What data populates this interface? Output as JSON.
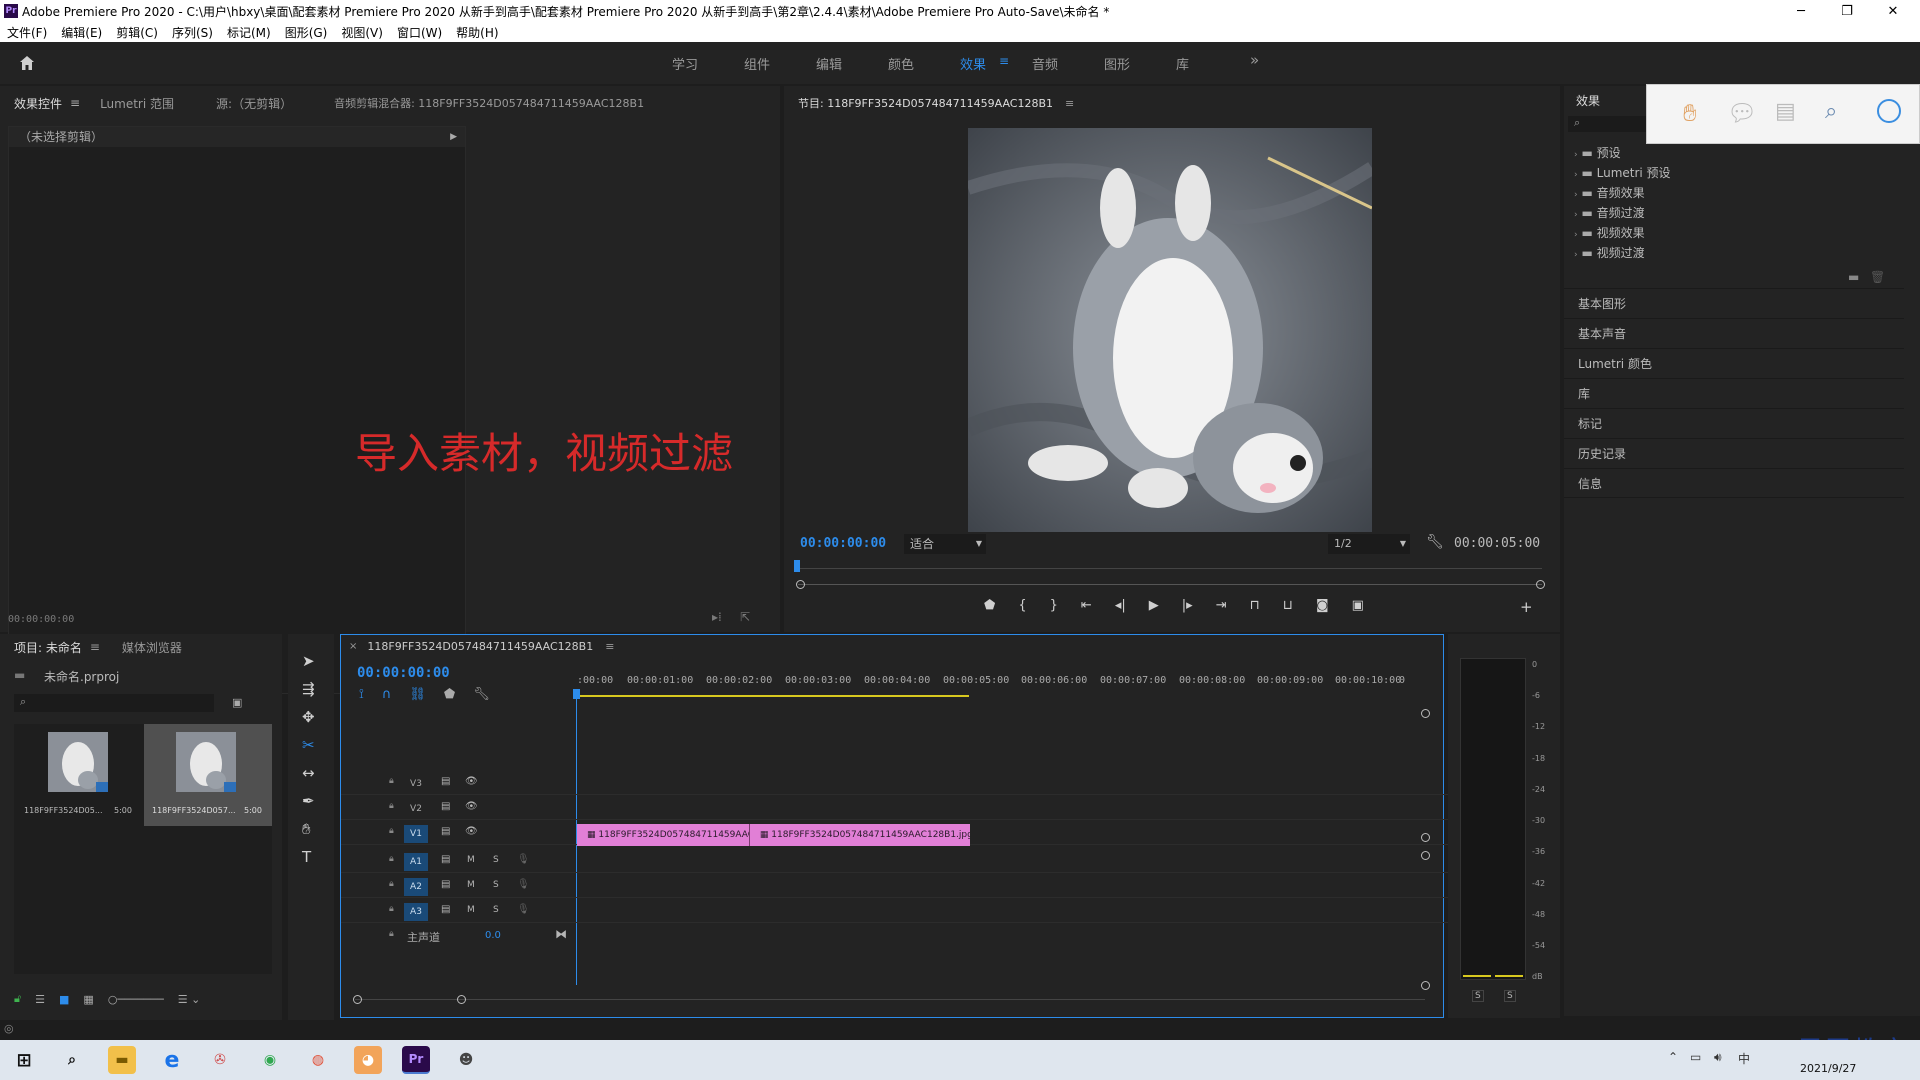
{
  "window": {
    "title": "Adobe Premiere Pro 2020 - C:\\用户\\hbxy\\桌面\\配套素材 Premiere Pro 2020 从新手到高手\\配套素材 Premiere Pro 2020 从新手到高手\\第2章\\2.4.4\\素材\\Adobe Premiere Pro Auto-Save\\未命名 *",
    "logo": "Pr"
  },
  "menu": [
    "文件(F)",
    "编辑(E)",
    "剪辑(C)",
    "序列(S)",
    "标记(M)",
    "图形(G)",
    "视图(V)",
    "窗口(W)",
    "帮助(H)"
  ],
  "workspaces": {
    "items": [
      "学习",
      "组件",
      "编辑",
      "颜色",
      "效果",
      "音频",
      "图形",
      "库"
    ],
    "active": "效果",
    "more": "»"
  },
  "source_panel": {
    "tabs": [
      "效果控件",
      "Lumetri 范围",
      "源:（无剪辑）",
      "音频剪辑混合器: 118F9FF3524D057484711459AAC128B1"
    ],
    "no_clip": "（未选择剪辑）",
    "timecode": "00:00:00:00"
  },
  "overlay_caption": "导入素材，视频过滤",
  "program_monitor": {
    "title": "节目: 118F9FF3524D057484711459AAC128B1",
    "timecode": "00:00:00:00",
    "zoom": "适合",
    "resolution": "1/2",
    "duration": "00:00:05:00",
    "playhead_fraction": 0.0
  },
  "effects_panel": {
    "title": "效果",
    "tree": [
      "预设",
      "Lumetri 预设",
      "音频效果",
      "音频过渡",
      "视频效果",
      "视频过渡"
    ],
    "sections": [
      "基本图形",
      "基本声音",
      "Lumetri 颜色",
      "库",
      "标记",
      "历史记录",
      "信息"
    ]
  },
  "project_panel": {
    "tabs": [
      "项目: 未命名",
      "媒体浏览器"
    ],
    "project_file": "未命名.prproj",
    "items": [
      {
        "name": "118F9FF3524D05...",
        "duration": "5:00",
        "selected": false
      },
      {
        "name": "118F9FF3524D057...",
        "duration": "5:00",
        "selected": true
      }
    ]
  },
  "timeline": {
    "tab": "118F9FF3524D057484711459AAC128B1",
    "timecode": "00:00:00:00",
    "ruler": [
      ":00:00",
      "00:00:01:00",
      "00:00:02:00",
      "00:00:03:00",
      "00:00:04:00",
      "00:00:05:00",
      "00:00:06:00",
      "00:00:07:00",
      "00:00:08:00",
      "00:00:09:00",
      "00:00:10:00",
      "0"
    ],
    "video_tracks": [
      "V3",
      "V2",
      "V1"
    ],
    "audio_tracks": [
      "A1",
      "A2",
      "A3"
    ],
    "master": {
      "label": "主声道",
      "value": "0.0"
    },
    "clips": [
      {
        "label": "118F9FF3524D057484711459AAC",
        "track": "V1",
        "start": 0.0,
        "end": 2.2
      },
      {
        "label": "118F9FF3524D057484711459AAC128B1.jpg",
        "track": "V1",
        "start": 2.2,
        "end": 5.0
      }
    ],
    "track_buttons": {
      "mute": "M",
      "solo": "S"
    }
  },
  "audio_meter": {
    "scale": [
      "0",
      "-6",
      "-12",
      "-18",
      "-24",
      "-30",
      "-36",
      "-42",
      "-48",
      "-54",
      "dB"
    ],
    "solo_labels": [
      "S",
      "S"
    ]
  },
  "watermark": "最需教育",
  "tray": {
    "ime": "中",
    "date": "2021/9/27"
  },
  "colors": {
    "accent": "#2d8ceb",
    "clip": "#e17fd6",
    "caption": "#d62a2a",
    "work_area": "#d7c81f"
  }
}
